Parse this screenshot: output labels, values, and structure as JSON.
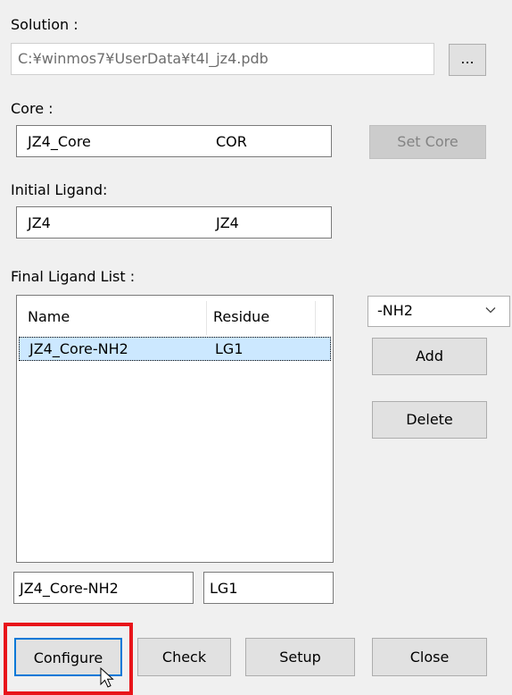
{
  "solution": {
    "label": "Solution :",
    "path": "C:¥winmos7¥UserData¥t4l_jz4.pdb",
    "browse_label": "..."
  },
  "core": {
    "label": "Core :",
    "name": "JZ4_Core",
    "code": "COR",
    "set_core_label": "Set Core"
  },
  "initial_ligand": {
    "label": "Initial Ligand:",
    "name": "JZ4",
    "code": "JZ4"
  },
  "final_ligand_list": {
    "label": "Final Ligand List :",
    "columns": [
      "Name",
      "Residue"
    ],
    "rows": [
      {
        "name": "JZ4_Core-NH2",
        "residue": "LG1"
      }
    ],
    "selected_row": 0,
    "edit_name": "JZ4_Core-NH2",
    "edit_residue": "LG1"
  },
  "group_dropdown": {
    "value": "-NH2"
  },
  "buttons": {
    "add": "Add",
    "delete": "Delete",
    "configure": "Configure",
    "check": "Check",
    "setup": "Setup",
    "close": "Close"
  },
  "colors": {
    "highlight": "#e8141a",
    "selection": "#cce8ff",
    "focus_border": "#0078d7"
  }
}
